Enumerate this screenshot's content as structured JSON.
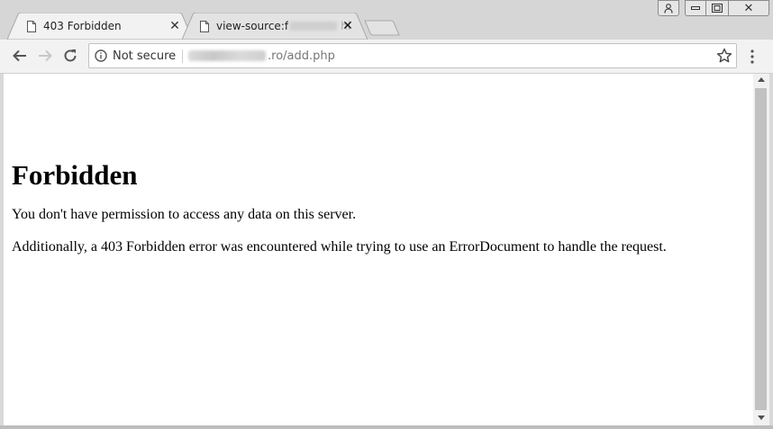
{
  "tabs": [
    {
      "title": "403 Forbidden",
      "active": true
    },
    {
      "title": "view-source:f",
      "title_trailing": "hi",
      "active": false
    }
  ],
  "toolbar": {
    "security_label": "Not secure",
    "url_suffix": ".ro/add.php"
  },
  "page": {
    "heading": "Forbidden",
    "message": "You don't have permission to access any data on this server.",
    "detail": "Additionally, a 403 Forbidden error was encountered while trying to use an ErrorDocument to handle the request."
  },
  "icons": {
    "tab": "document-icon",
    "close": "close-icon",
    "back": "back-arrow-icon",
    "forward": "forward-arrow-icon",
    "reload": "reload-icon",
    "info": "info-icon",
    "bookmark": "star-icon",
    "menu": "kebab-menu-icon",
    "profile": "user-icon",
    "minimize": "minimize-icon",
    "restore": "restore-icon",
    "window_close": "window-close-icon"
  },
  "colors": {
    "tabstrip": "#d6d6d6",
    "active_tab": "#f2f2f2",
    "inactive_tab": "#e3e3e3",
    "content_bg": "#ffffff",
    "scroll_thumb": "#c1c1c1"
  }
}
